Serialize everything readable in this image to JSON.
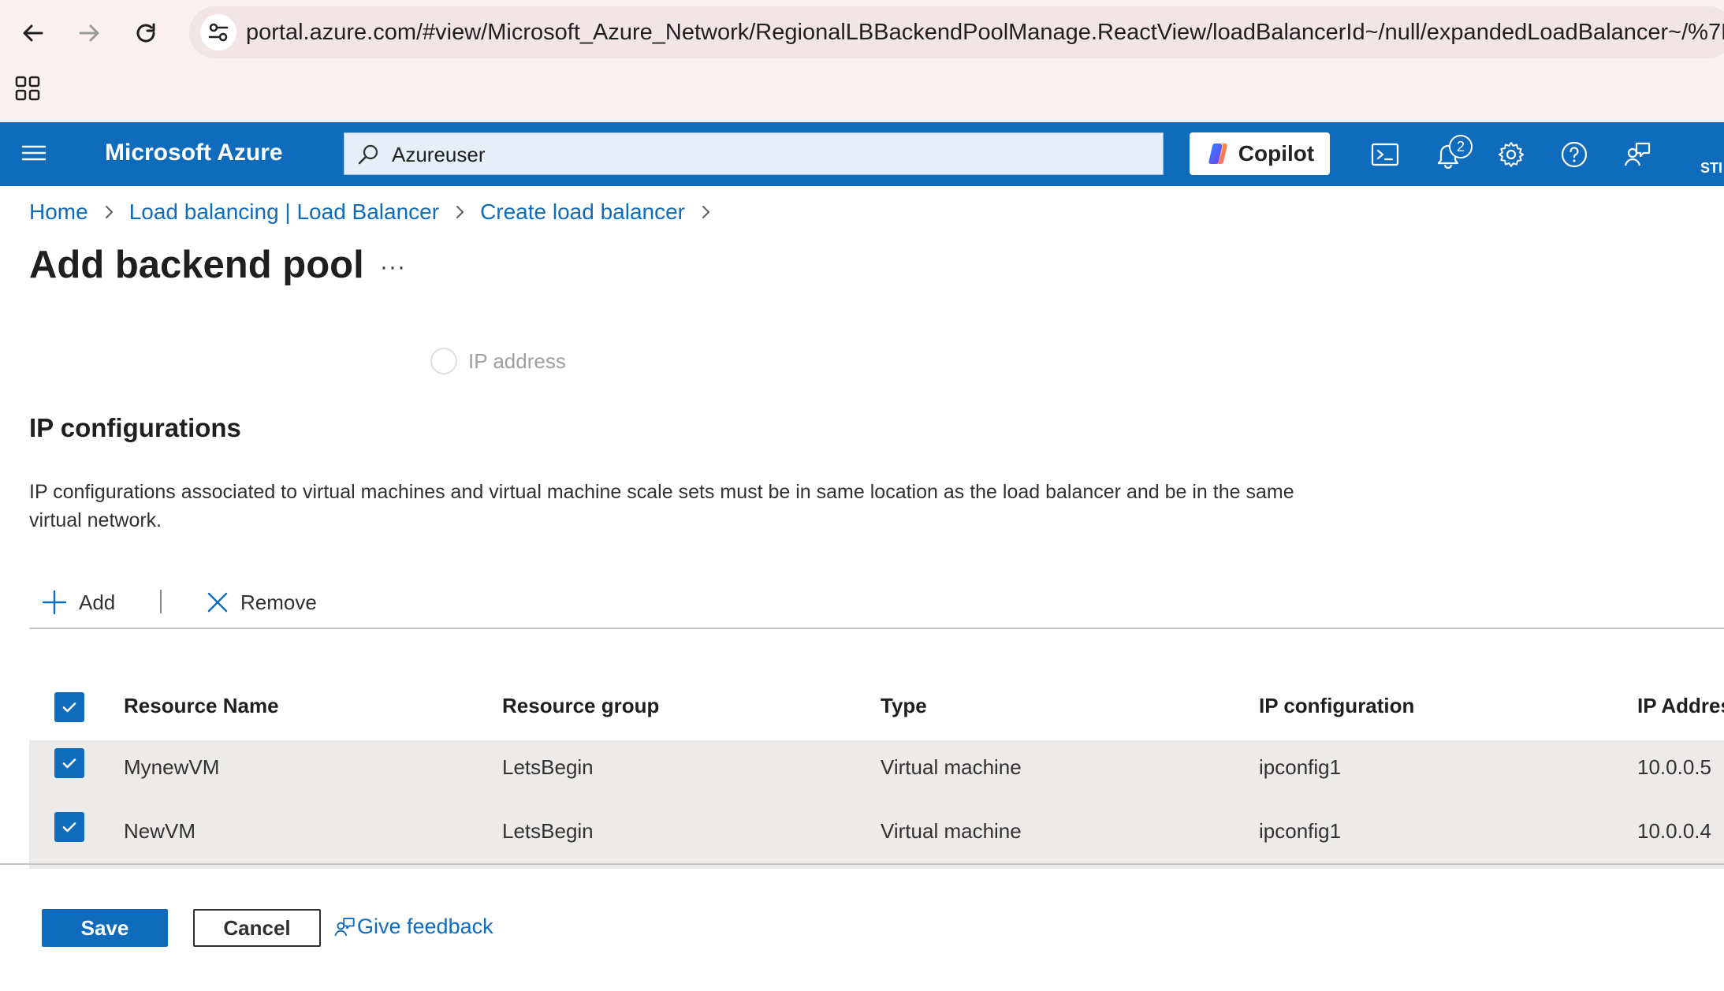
{
  "browser": {
    "url": "portal.azure.com/#view/Microsoft_Azure_Network/RegionalLBBackendPoolManage.ReactView/loadBalancerId~/null/expandedLoadBalancer~/%7B\"n..."
  },
  "header": {
    "brand": "Microsoft Azure",
    "search_value": "Azureuser",
    "copilot_label": "Copilot",
    "notification_count": "2",
    "user_initials": "STI",
    "color": "#0f6cbd"
  },
  "breadcrumb": [
    "Home",
    "Load balancing | Load Balancer",
    "Create load balancer"
  ],
  "page": {
    "title": "Add backend pool",
    "more": "···"
  },
  "radio": {
    "label": "IP address",
    "selected": false
  },
  "section": {
    "title": "IP configurations",
    "description": "IP configurations associated to virtual machines and virtual machine scale sets must be in same location as the load balancer and be in the same virtual network."
  },
  "toolbar": {
    "add_label": "Add",
    "remove_label": "Remove"
  },
  "table": {
    "columns": [
      "Resource Name",
      "Resource group",
      "Type",
      "IP configuration",
      "IP Addres"
    ],
    "rows": [
      {
        "name": "MynewVM",
        "group": "LetsBegin",
        "type": "Virtual machine",
        "ipconfig": "ipconfig1",
        "ip": "10.0.0.5",
        "checked": true
      },
      {
        "name": "NewVM",
        "group": "LetsBegin",
        "type": "Virtual machine",
        "ipconfig": "ipconfig1",
        "ip": "10.0.0.4",
        "checked": true
      }
    ]
  },
  "footer": {
    "save_label": "Save",
    "cancel_label": "Cancel",
    "feedback_label": "Give feedback"
  }
}
